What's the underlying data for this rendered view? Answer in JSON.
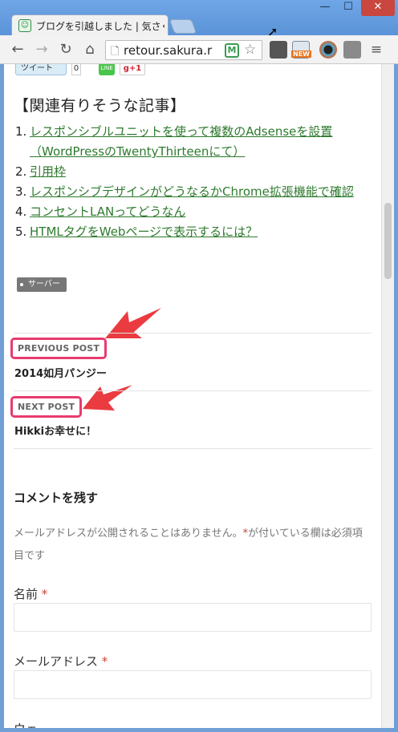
{
  "browser": {
    "tab_title": "ブログを引越しました | 気さく",
    "url": "retour.sakura.r",
    "ext_new_badge": "NEW",
    "ext_m_label": "M"
  },
  "share": {
    "tweet_label": "ツイート",
    "tweet_count": "0",
    "line_label": "LINE",
    "gplus_label": "g+1"
  },
  "related": {
    "heading": "【関連有りそうな記事】",
    "items": [
      {
        "num": "1.",
        "text": "レスポンシブルユニットを使って複数のAdsenseを設置（WordPressのTwentyThirteenにて）"
      },
      {
        "num": "2.",
        "text": "引用枠"
      },
      {
        "num": "3.",
        "text": "レスポンシブデザインがどうなるかChrome拡張機能で確認"
      },
      {
        "num": "4.",
        "text": "コンセントLANってどうなん"
      },
      {
        "num": "5.",
        "text": "HTMLタグをWebページで表示するには？"
      }
    ]
  },
  "tag": {
    "label": "サーバー"
  },
  "post_nav": {
    "previous": {
      "label": "PREVIOUS POST",
      "title": "2014如月パンジー"
    },
    "next": {
      "label": "NEXT POST",
      "title": "Hikkiお幸せに！"
    }
  },
  "comments": {
    "heading": "コメントを残す",
    "note": "メールアドレスが公開されることはありません。",
    "note_star": "*",
    "note_tail": "が付いている欄は必須項目です",
    "name_label": "名前",
    "email_label": "メールアドレス",
    "required_mark": "*",
    "next_label_partial": "ウェ"
  },
  "colors": {
    "link": "#2e7a2e",
    "highlight": "#e83b6e",
    "arrow": "#e8262c",
    "required": "#c9443b"
  }
}
